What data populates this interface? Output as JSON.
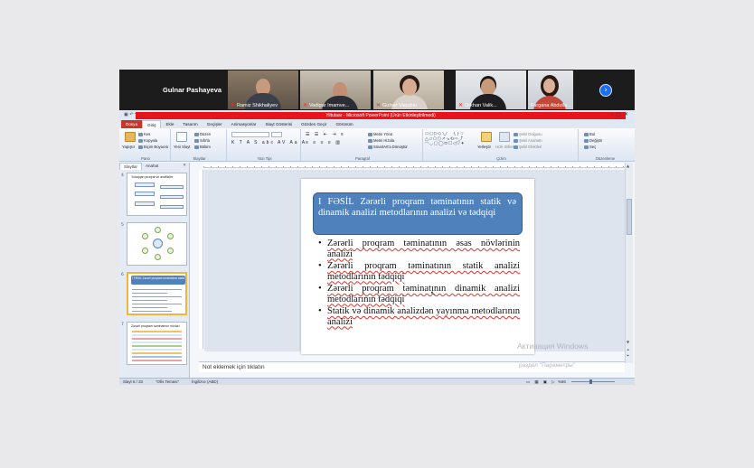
{
  "zoom": {
    "host_name": "Gulnar Pashayeva",
    "participants": [
      {
        "name": "Ramiz Shikhaliyev"
      },
      {
        "name": "Vadigar Imamve..."
      },
      {
        "name": "Gulnar Vaqublu"
      },
      {
        "name": "Orkhan Valik..."
      },
      {
        "name": "Fargana Abdulla..."
      }
    ],
    "next_icon": "chevron-right-icon"
  },
  "ppt": {
    "window_title": "Yiltutaar - Microsoft PowerPoint (Ürün Etkinleştirilmedi)",
    "tabs": [
      "Dosya",
      "Giriş",
      "Ekle",
      "Tasarım",
      "Geçişler",
      "Animasyonlar",
      "Slayt Gösterisi",
      "Gözden Geçir",
      "Görünüm"
    ],
    "active_tab": "Giriş",
    "ribbon": {
      "clipboard": {
        "label": "Pano",
        "paste": "Yapıştır",
        "cut": "Kes",
        "copy": "Kopyala",
        "format_painter": "Biçim Boyacısı"
      },
      "slides": {
        "label": "Slaytlar",
        "new_slide": "Yeni Slayt",
        "layout": "Düzen",
        "reset": "Sıfırla",
        "section": "Bölüm"
      },
      "font": {
        "label": "Yazı Tipi"
      },
      "paragraph": {
        "label": "Paragraf",
        "text_direction": "Metin Yönü",
        "align_text": "Metni Hizala",
        "smartart": "SmartArt'a Dönüştür"
      },
      "drawing": {
        "label": "Çizim",
        "arrange": "Yerleştir",
        "quick_styles": "Hızlı Stiller",
        "shape_fill": "Şekil Dolgusu",
        "shape_outline": "Şekil Anahattı",
        "shape_effects": "Şekil Efektleri"
      },
      "editing": {
        "label": "Düzenleme",
        "find": "Bul",
        "replace": "Değiştir",
        "select": "Seç"
      }
    },
    "left_panel": {
      "tabs": [
        "Slaytlar",
        "Anahat"
      ],
      "thumbnails": [
        {
          "number": "4",
          "title": "Yoluqqan proqrat ve anaflizler"
        },
        {
          "number": "5"
        },
        {
          "number": "6",
          "selected": true,
          "title": "I FƏSİL Zərərli proqram təminatının statik və dinamik analizi"
        },
        {
          "number": "7",
          "title": "Zərərli proqram təminatının növləri"
        }
      ]
    },
    "slide": {
      "title_chapter": "I FƏSİL",
      "title_text": "Zərərli proqram təminatının statik və dinamik analizi metodlarının analizi və tədqiqi",
      "bullets": [
        "Zərərli proqram təminatının əsas növlərinin analizi",
        "Zərərli proqram təminatının statik analizi metodlarının tədqiqi",
        "Zərərli proqram təminatının dinamik analizi metodlarının tədqiqi",
        "Statik və dinamik analizdən yayınma metodlarının analizi"
      ]
    },
    "notes_placeholder": "Not eklemek için tıklatın",
    "watermark_line1": "Активация Windows",
    "watermark_line2": "раздел \"Параметры\"",
    "status": {
      "slide_count": "Slayt 6 / 33",
      "theme": "\"Ofis Teması\"",
      "language": "İngilizce (ABD)",
      "zoom": "%66"
    }
  }
}
